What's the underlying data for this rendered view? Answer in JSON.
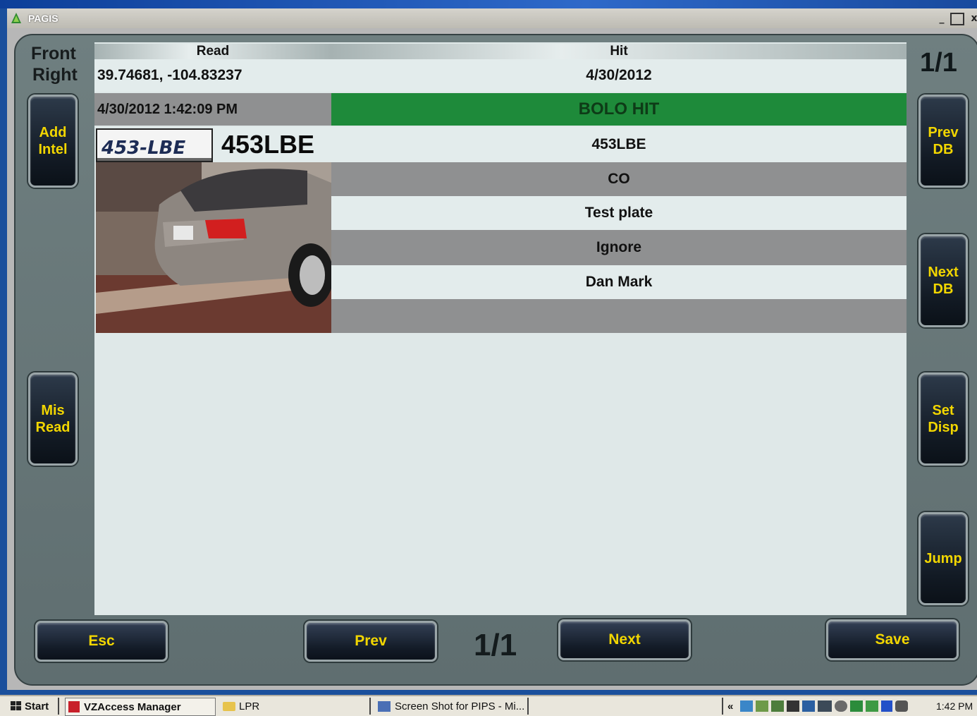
{
  "window": {
    "title": "PAGIS",
    "minimize": "_",
    "maximize": "□",
    "close": "x"
  },
  "camera": {
    "line1": "Front",
    "line2": "Right"
  },
  "counter": {
    "top": "1/1",
    "bottom": "1/1"
  },
  "headers": {
    "read": "Read",
    "hit": "Hit"
  },
  "read": {
    "coordinates": "39.74681, -104.83237",
    "timestamp": "4/30/2012 1:42:09 PM",
    "plate_number": "453LBE",
    "plate_image_text": "453-LBE"
  },
  "hit": {
    "date": "4/30/2012",
    "status": "BOLO HIT",
    "plate": "453LBE",
    "state": "CO",
    "note": "Test plate",
    "action": "Ignore",
    "officer": "Dan Mark",
    "extra": ""
  },
  "left_buttons": {
    "add_intel": [
      "Add",
      "Intel"
    ],
    "mis_read": [
      "Mis",
      "Read"
    ]
  },
  "right_buttons": {
    "prev_db": [
      "Prev",
      "DB"
    ],
    "next_db": [
      "Next",
      "DB"
    ],
    "set_disp": [
      "Set",
      "Disp"
    ],
    "jump": "Jump"
  },
  "bottom_buttons": {
    "esc": "Esc",
    "prev": "Prev",
    "next": "Next",
    "save": "Save"
  },
  "colors": {
    "bolo": "#1e8a3a",
    "button_text": "#f2d600"
  },
  "taskbar": {
    "start": "Start",
    "items": [
      "VZAccess Manager",
      "LPR",
      "Screen Shot for PIPS - Mi..."
    ],
    "tray_chevron": "«",
    "clock": "1:42 PM"
  }
}
